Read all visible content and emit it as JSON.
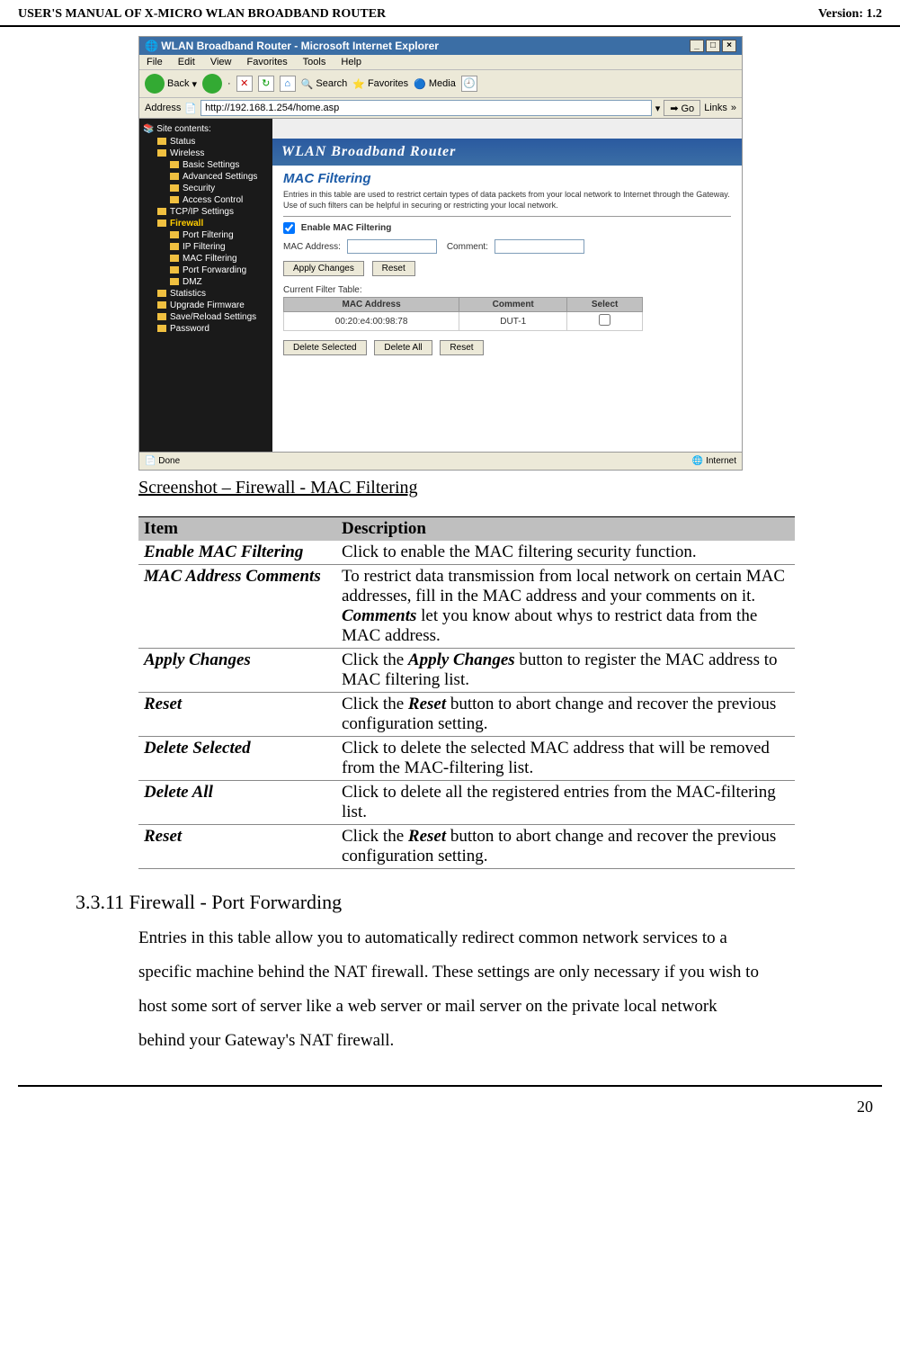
{
  "header": {
    "left": "USER'S MANUAL OF X-MICRO WLAN BROADBAND ROUTER",
    "right": "Version: 1.2"
  },
  "browser": {
    "title": "WLAN Broadband Router - Microsoft Internet Explorer",
    "menu": [
      "File",
      "Edit",
      "View",
      "Favorites",
      "Tools",
      "Help"
    ],
    "toolbar": {
      "back": "Back",
      "search": "Search",
      "favorites": "Favorites",
      "media": "Media"
    },
    "address_label": "Address",
    "address_value": "http://192.168.1.254/home.asp",
    "go": "Go",
    "links": "Links",
    "banner": "WLAN Broadband Router",
    "sidebar_title": "Site contents:",
    "sidebar": [
      {
        "label": "Status",
        "sub": false
      },
      {
        "label": "Wireless",
        "sub": false
      },
      {
        "label": "Basic Settings",
        "sub": true
      },
      {
        "label": "Advanced Settings",
        "sub": true
      },
      {
        "label": "Security",
        "sub": true
      },
      {
        "label": "Access Control",
        "sub": true
      },
      {
        "label": "TCP/IP Settings",
        "sub": false
      },
      {
        "label": "Firewall",
        "sub": false,
        "sel": true
      },
      {
        "label": "Port Filtering",
        "sub": true
      },
      {
        "label": "IP Filtering",
        "sub": true
      },
      {
        "label": "MAC Filtering",
        "sub": true
      },
      {
        "label": "Port Forwarding",
        "sub": true
      },
      {
        "label": "DMZ",
        "sub": true
      },
      {
        "label": "Statistics",
        "sub": false
      },
      {
        "label": "Upgrade Firmware",
        "sub": false
      },
      {
        "label": "Save/Reload Settings",
        "sub": false
      },
      {
        "label": "Password",
        "sub": false
      }
    ],
    "page": {
      "title": "MAC Filtering",
      "desc": "Entries in this table are used to restrict certain types of data packets from your local network to Internet through the Gateway. Use of such filters can be helpful in securing or restricting your local network.",
      "enable_label": "Enable MAC Filtering",
      "mac_label": "MAC Address:",
      "comment_label": "Comment:",
      "apply": "Apply Changes",
      "reset": "Reset",
      "cft_label": "Current Filter Table:",
      "th_mac": "MAC Address",
      "th_comment": "Comment",
      "th_select": "Select",
      "row_mac": "00:20:e4:00:98:78",
      "row_comment": "DUT-1",
      "del_sel": "Delete Selected",
      "del_all": "Delete All",
      "reset2": "Reset"
    },
    "status_done": "Done",
    "status_zone": "Internet"
  },
  "caption": "Screenshot – Firewall - MAC Filtering",
  "table": {
    "h_item": "Item",
    "h_desc": "Description",
    "rows": [
      {
        "item": "Enable MAC Filtering",
        "desc": "Click to enable the MAC filtering security function."
      },
      {
        "item": "MAC Address Comments",
        "desc_pre": "To restrict data transmission from local network on certain MAC addresses, fill in the MAC address and your comments on it.",
        "desc_b": "Comments",
        "desc_post": " let you know about whys to restrict data from the MAC address."
      },
      {
        "item": "Apply Changes",
        "desc_pre": "Click the ",
        "desc_b": "Apply Changes",
        "desc_post": " button to register the MAC address to MAC filtering list."
      },
      {
        "item": "Reset",
        "desc_pre": "Click the ",
        "desc_b": "Reset",
        "desc_post": " button to abort change and recover the previous configuration setting."
      },
      {
        "item": "Delete Selected",
        "desc": "Click to delete the selected MAC address that will be removed from the MAC-filtering list."
      },
      {
        "item": "Delete All",
        "desc": "Click to delete all the registered entries from the MAC-filtering list."
      },
      {
        "item": "Reset",
        "desc_pre": "Click the ",
        "desc_b": "Reset",
        "desc_post": " button to abort change and recover the previous configuration setting."
      }
    ]
  },
  "section": {
    "heading": "3.3.11 Firewall - Port Forwarding",
    "body": "Entries in this table allow you to automatically redirect common network services to a specific machine behind the NAT firewall. These settings are only necessary if you wish to host some sort of server like a web server or mail server on the private local network behind your Gateway's NAT firewall."
  },
  "page_number": "20"
}
